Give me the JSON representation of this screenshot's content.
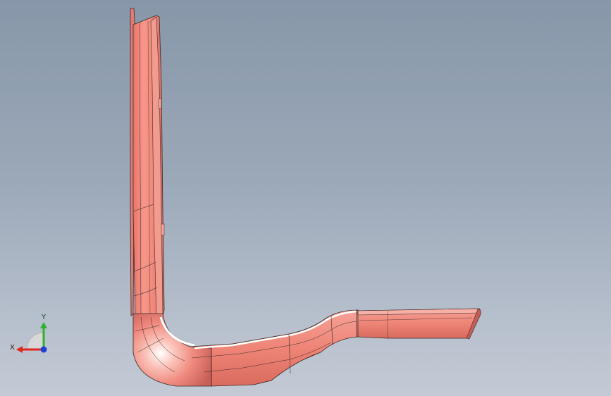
{
  "view": {
    "background_top": "#8797a9",
    "background_bottom": "#c3cad5"
  },
  "part": {
    "name": "bent-tube-part",
    "color": "#f08a7e",
    "edge_color": "#3a2a28"
  },
  "triad": {
    "x_label": "X",
    "y_label": "Y",
    "x_color": "#e0281e",
    "y_color": "#2fb12f",
    "z_color": "#1f3fd6"
  }
}
